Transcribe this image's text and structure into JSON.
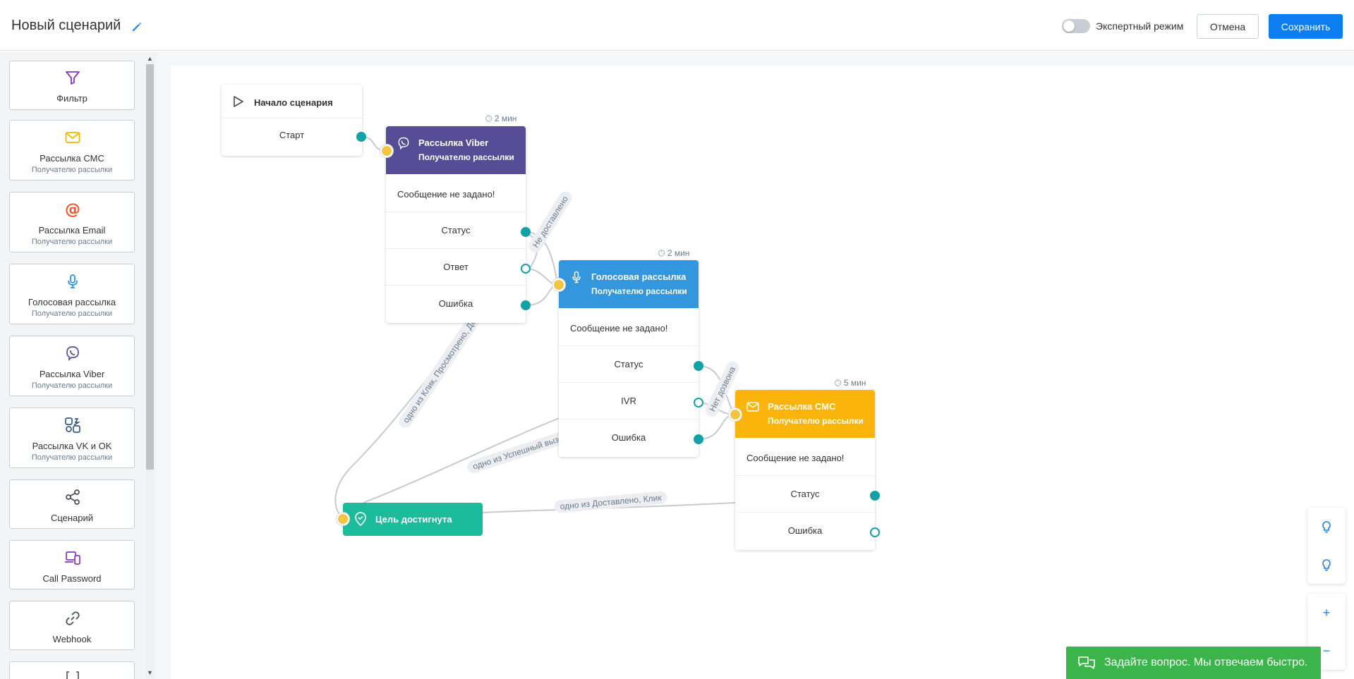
{
  "header": {
    "title": "Новый сценарий",
    "expert_mode": "Экспертный режим",
    "cancel": "Отмена",
    "save": "Сохранить"
  },
  "palette": [
    {
      "label": "Фильтр",
      "sub": "",
      "icon": "filter-icon"
    },
    {
      "label": "Рассылка СМС",
      "sub": "Получателю рассылки",
      "icon": "envelope-icon"
    },
    {
      "label": "Рассылка Email",
      "sub": "Получателю рассылки",
      "icon": "at-sign-icon"
    },
    {
      "label": "Голосовая рассылка",
      "sub": "Получателю рассылки",
      "icon": "microphone-icon"
    },
    {
      "label": "Рассылка Viber",
      "sub": "Получателю рассылки",
      "icon": "viber-icon"
    },
    {
      "label": "Рассылка VK и OK",
      "sub": "Получателю рассылки",
      "icon": "vk-ok-icon"
    },
    {
      "label": "Сценарий",
      "sub": "",
      "icon": "share-icon"
    },
    {
      "label": "Call Password",
      "sub": "",
      "icon": "devices-icon"
    },
    {
      "label": "Webhook",
      "sub": "",
      "icon": "link-icon"
    }
  ],
  "nodes": {
    "start": {
      "title": "Начало сценария",
      "row": "Старт"
    },
    "viber": {
      "title": "Рассылка Viber",
      "subtitle": "Получателю рассылки",
      "time": "2 мин",
      "message": "Сообщение не задано!",
      "rows": [
        "Статус",
        "Ответ",
        "Ошибка"
      ],
      "color": "#574c96"
    },
    "voice": {
      "title": "Голосовая рассылка",
      "subtitle": "Получателю рассылки",
      "time": "2 мин",
      "message": "Сообщение не задано!",
      "rows": [
        "Статус",
        "IVR",
        "Ошибка"
      ],
      "color": "#3497dd"
    },
    "sms": {
      "title": "Рассылка СМС",
      "subtitle": "Получателю рассылки",
      "time": "5 мин",
      "message": "Сообщение не задано!",
      "rows": [
        "Статус",
        "Ошибка"
      ],
      "color": "#fbb40a"
    },
    "goal": {
      "title": "Цель достигнута",
      "color": "#1bbc9b"
    }
  },
  "edge_labels": {
    "viber_status": "Не доставлено",
    "viber_goal": "одно из Клик, Просмотрено, Доставлено",
    "voice_status": "Нет дозвона",
    "voice_goal": "одно из Успешный вызов",
    "sms_goal": "одно из Доставлено, Клик"
  },
  "chat": {
    "text": "Задайте вопрос. Мы отвечаем быстро."
  }
}
